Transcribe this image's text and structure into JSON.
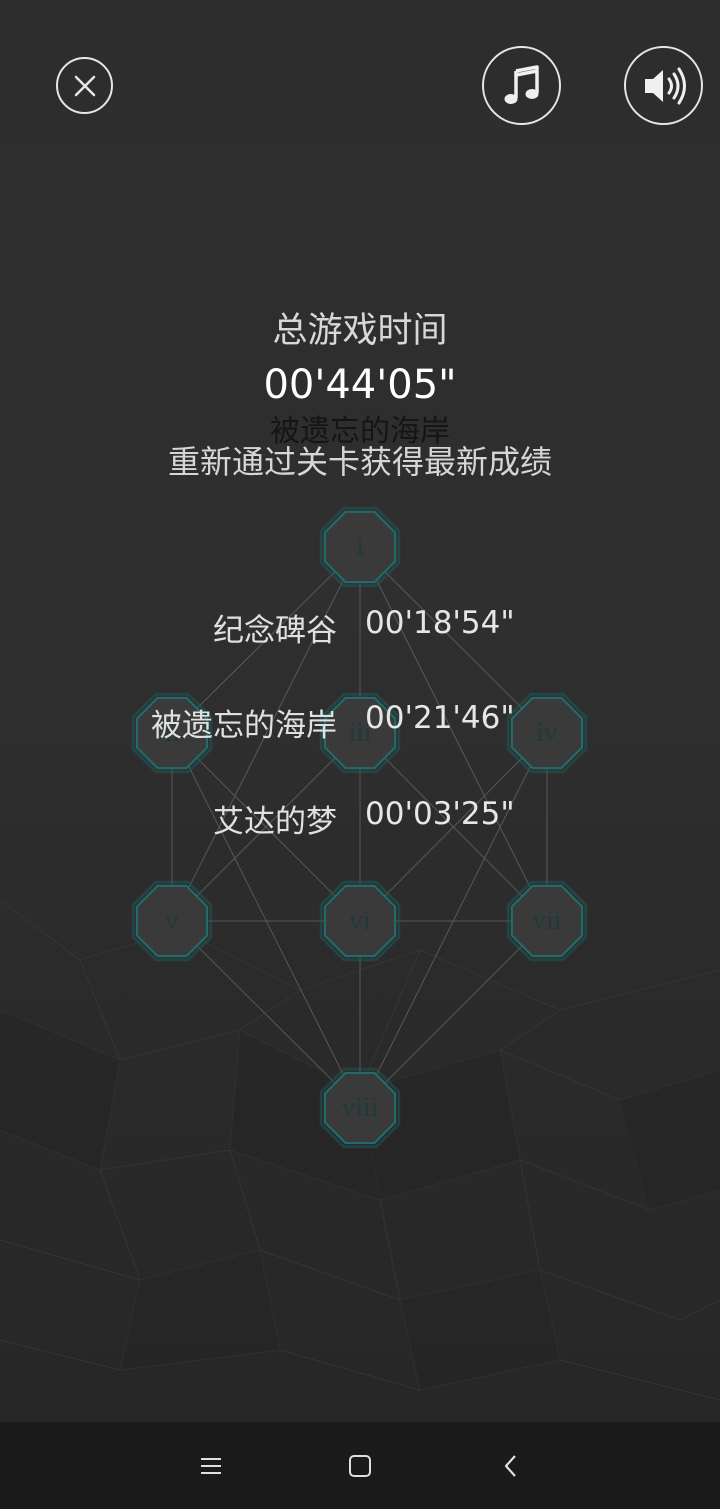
{
  "header": {
    "close_icon": "close-icon",
    "music_icon": "music-note-icon",
    "sound_icon": "speaker-volume-icon"
  },
  "summary": {
    "total_title": "总游戏时间",
    "total_time": "00'44'05\"",
    "level_name": "被遗忘的海岸",
    "replay_hint": "重新通过关卡获得最新成绩"
  },
  "level_nodes": [
    {
      "id": "i",
      "label": "i"
    },
    {
      "id": "ii",
      "label": "ii"
    },
    {
      "id": "iii",
      "label": "iii"
    },
    {
      "id": "iv",
      "label": "iv"
    },
    {
      "id": "v",
      "label": "v"
    },
    {
      "id": "vi",
      "label": "vi"
    },
    {
      "id": "vii",
      "label": "vii"
    },
    {
      "id": "viii",
      "label": "viii"
    }
  ],
  "scores": [
    {
      "name": "纪念碑谷",
      "time": "00'18'54\""
    },
    {
      "name": "被遗忘的海岸",
      "time": "00'21'46\""
    },
    {
      "name": "艾达的梦",
      "time": "00'03'25\""
    }
  ],
  "colors": {
    "background": "#2d2d2d",
    "node_fill": "#3a3a3a",
    "node_stroke": "#1f6f6f",
    "navbar": "#1a1a1a",
    "text": "#e6e6e6"
  },
  "navbar": {
    "menu_icon": "menu-icon",
    "home_icon": "home-square-icon",
    "back_icon": "back-chevron-icon"
  }
}
